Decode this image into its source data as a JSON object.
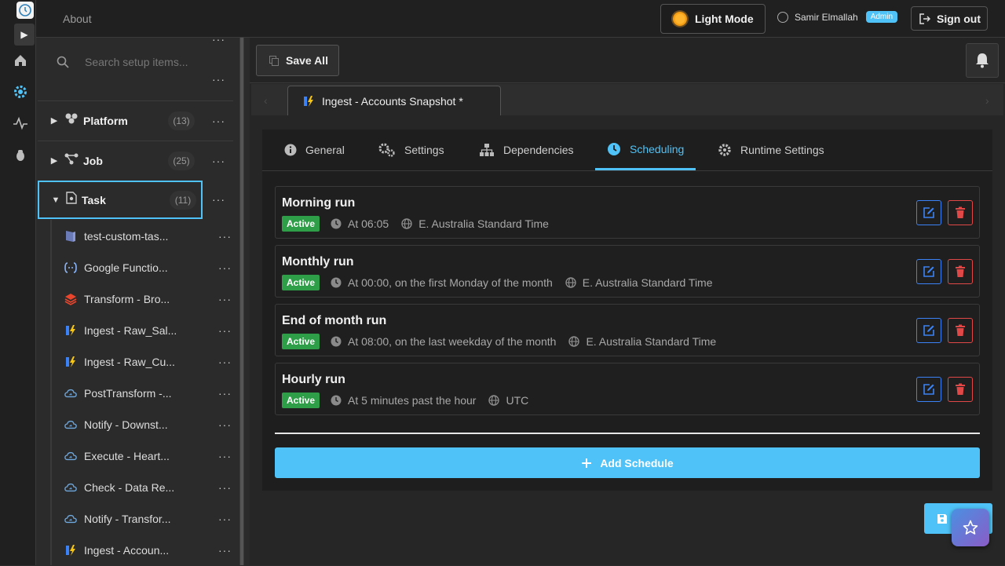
{
  "header": {
    "about_label": "About",
    "theme_button_label": "Light Mode",
    "user_name": "Samir Elmallah",
    "user_role": "Admin",
    "signout_label": "Sign out"
  },
  "sidebar": {
    "search_placeholder": "Search setup items...",
    "groups": [
      {
        "label": "Platform",
        "count": "(13)",
        "expanded": false
      },
      {
        "label": "Job",
        "count": "(25)",
        "expanded": false
      },
      {
        "label": "Task",
        "count": "(11)",
        "expanded": true
      }
    ],
    "task_items": [
      {
        "label": "test-custom-tas...",
        "icon": "stack-icon"
      },
      {
        "label": "Google Functio...",
        "icon": "function-icon"
      },
      {
        "label": "Transform - Bro...",
        "icon": "layers-icon"
      },
      {
        "label": "Ingest - Raw_Sal...",
        "icon": "ingest-icon"
      },
      {
        "label": "Ingest - Raw_Cu...",
        "icon": "ingest-icon"
      },
      {
        "label": "PostTransform -...",
        "icon": "cloud-icon"
      },
      {
        "label": "Notify - Downst...",
        "icon": "cloud-icon"
      },
      {
        "label": "Execute - Heart...",
        "icon": "cloud-icon"
      },
      {
        "label": "Check - Data Re...",
        "icon": "cloud-icon"
      },
      {
        "label": "Notify - Transfor...",
        "icon": "cloud-icon"
      },
      {
        "label": "Ingest - Accoun...",
        "icon": "ingest-icon"
      }
    ]
  },
  "toolbar": {
    "save_all_label": "Save All"
  },
  "document_tab": {
    "label": "Ingest - Accounts Snapshot *"
  },
  "tabs": [
    {
      "label": "General",
      "icon": "info-icon",
      "active": false
    },
    {
      "label": "Settings",
      "icon": "gears-icon",
      "active": false
    },
    {
      "label": "Dependencies",
      "icon": "sitemap-icon",
      "active": false
    },
    {
      "label": "Scheduling",
      "icon": "clock-icon",
      "active": true
    },
    {
      "label": "Runtime Settings",
      "icon": "gear-icon",
      "active": false
    }
  ],
  "schedules": [
    {
      "name": "Morning run",
      "status": "Active",
      "when": "At 06:05",
      "timezone": "E. Australia Standard Time"
    },
    {
      "name": "Monthly run",
      "status": "Active",
      "when": "At 00:00, on the first Monday of the month",
      "timezone": "E. Australia Standard Time"
    },
    {
      "name": "End of month run",
      "status": "Active",
      "when": "At 08:00, on the last weekday of the month",
      "timezone": "E. Australia Standard Time"
    },
    {
      "name": "Hourly run",
      "status": "Active",
      "when": "At 5 minutes past the hour",
      "timezone": "UTC"
    }
  ],
  "add_schedule_label": "Add Schedule",
  "colors": {
    "accent": "#4fc3f7",
    "active_badge": "#2e9e48",
    "edit": "#3b82f6",
    "delete": "#e04848"
  }
}
